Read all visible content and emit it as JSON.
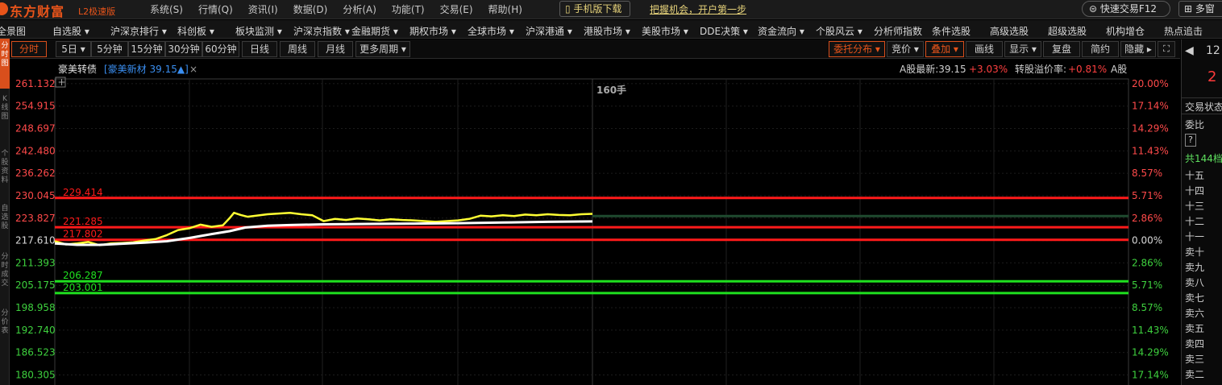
{
  "app": {
    "logo": "东方财富",
    "edition": "L2极速版",
    "menu": [
      "系统(S)",
      "行情(Q)",
      "资讯(I)",
      "数据(D)",
      "分析(A)",
      "功能(T)",
      "交易(E)",
      "帮助(H)"
    ],
    "mobile_download": "手机版下载",
    "promo": "把握机会，开户第一步",
    "quick_trade": "快速交易F12",
    "multi_window": "多窗"
  },
  "nav": [
    "全景图",
    "自选股 ▾",
    "沪深京排行 ▾",
    "科创板 ▾",
    "板块监测 ▾",
    "沪深京指数 ▾",
    "金融期货 ▾",
    "期权市场 ▾",
    "全球市场 ▾",
    "沪深港通 ▾",
    "港股市场 ▾",
    "美股市场 ▾",
    "DDE决策 ▾",
    "资金流向 ▾",
    "个股风云 ▾",
    "分析师指数",
    "条件选股",
    "高级选股",
    "超级选股",
    "机构增仓",
    "热点追击"
  ],
  "vtabs": [
    "分时图",
    "K线图",
    "个股资料",
    "自选股",
    "分时成交",
    "分价表"
  ],
  "periods": [
    "分时",
    "5日 ▾",
    "5分钟",
    "15分钟",
    "30分钟",
    "60分钟",
    "日线",
    "周线",
    "月线",
    "更多周期 ▾"
  ],
  "tools": [
    "委托分布 ▾",
    "竞价 ▾",
    "叠加 ▾",
    "画线",
    "显示 ▾",
    "复盘",
    "简约",
    "隐藏 ▸"
  ],
  "header": {
    "name": "豪美转债",
    "overlay": "[豪美新材 39.15▲]",
    "close": "×",
    "plus": "+",
    "a_latest": "A股最新:39.15",
    "a_change": "+3.03%",
    "premium_label": "转股溢价率:",
    "premium_value": "+0.81%",
    "a_share": "A股"
  },
  "chart_data": {
    "type": "line",
    "volume_label": "160手",
    "y_ticks_left": [
      "261.132",
      "254.915",
      "248.697",
      "242.480",
      "236.262",
      "230.045",
      "223.827",
      "217.610",
      "211.393",
      "205.175",
      "198.958",
      "192.740",
      "186.523",
      "180.305"
    ],
    "y_ticks_right": [
      "20.00%",
      "17.14%",
      "14.29%",
      "11.43%",
      "8.57%",
      "5.71%",
      "2.86%",
      "0.00%",
      "2.86%",
      "5.71%",
      "8.57%",
      "11.43%",
      "14.29%",
      "17.14%"
    ],
    "ylim": [
      177.5,
      262.0
    ],
    "prev_close": 217.61,
    "ref_lines": [
      {
        "value": 229.414,
        "label": "229.414",
        "color": "#ff1a1a"
      },
      {
        "value": 221.285,
        "label": "221.285",
        "color": "#ff1a1a"
      },
      {
        "value": 217.802,
        "label": "217.802",
        "color": "#ff1a1a"
      },
      {
        "value": 206.287,
        "label": "206.287",
        "color": "#1fe01f"
      },
      {
        "value": 203.001,
        "label": "203.001",
        "color": "#1fe01f"
      }
    ],
    "total_minutes": 240,
    "series": [
      {
        "color": "#ffff33",
        "x": [
          0,
          5,
          10,
          15,
          20,
          25,
          30,
          35,
          40,
          45,
          50,
          55,
          60,
          65,
          70,
          75,
          78,
          80,
          83,
          86,
          90,
          95,
          100,
          105,
          110,
          115,
          120,
          125,
          130,
          135,
          140,
          145,
          150,
          155,
          160,
          165,
          170,
          175,
          180,
          185,
          190,
          195,
          200,
          205,
          210,
          215,
          220,
          225,
          230,
          235,
          240
        ],
        "values": [
          217.4,
          216.5,
          216.8,
          217.2,
          216.3,
          216.8,
          216.9,
          217.1,
          217.6,
          218.0,
          219.1,
          220.5,
          221.0,
          222.0,
          221.4,
          221.8,
          223.8,
          225.3,
          224.7,
          224.2,
          224.5,
          224.9,
          225.1,
          225.3,
          224.9,
          224.6,
          223.0,
          223.6,
          223.3,
          223.7,
          223.5,
          223.2,
          223.5,
          223.3,
          223.2,
          223.0,
          222.8,
          223.0,
          223.2,
          223.6,
          224.5,
          224.3,
          224.6,
          224.4,
          224.8,
          224.6,
          224.9,
          224.7,
          224.6,
          224.9,
          225.0
        ]
      },
      {
        "color": "#ffffff",
        "x": [
          0,
          10,
          20,
          30,
          40,
          50,
          60,
          70,
          78,
          85,
          95,
          105,
          120,
          140,
          160,
          180,
          200,
          220,
          240
        ],
        "values": [
          216.8,
          216.4,
          216.4,
          216.7,
          217.0,
          217.4,
          218.3,
          219.4,
          220.2,
          221.2,
          221.7,
          221.9,
          222.1,
          222.2,
          222.3,
          222.4,
          222.6,
          222.8,
          222.9
        ]
      }
    ]
  },
  "right_panel": {
    "top_value": "12",
    "big_value": "2",
    "trade_status": "交易状态",
    "weibi": "委比",
    "question": "?",
    "total": "共144档",
    "levels": [
      "十五",
      "十四",
      "十三",
      "十二",
      "十一",
      "卖十",
      "卖九",
      "卖八",
      "卖七",
      "卖六",
      "卖五",
      "卖四",
      "卖三",
      "卖二"
    ]
  }
}
